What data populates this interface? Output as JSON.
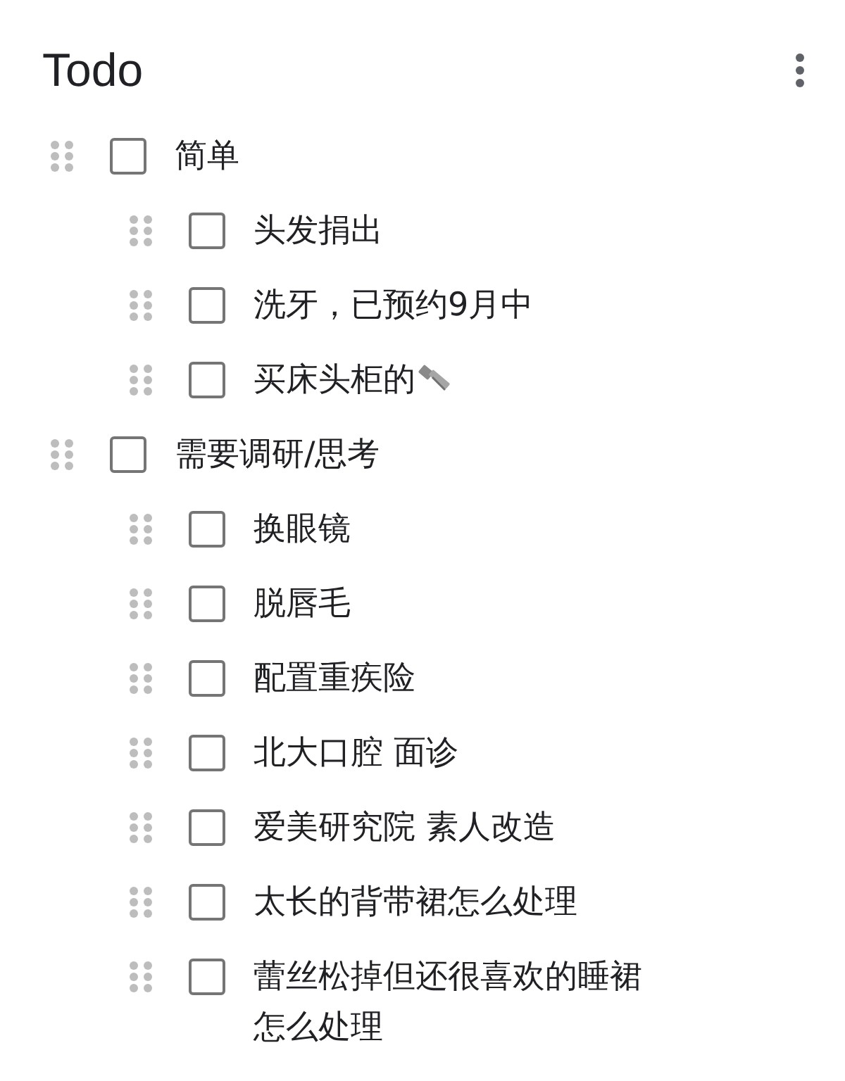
{
  "header": {
    "title": "Todo"
  },
  "items": [
    {
      "text": "简单",
      "checked": false,
      "children": [
        {
          "text": "头发捐出",
          "checked": false
        },
        {
          "text": "洗牙，已预约9月中",
          "checked": false
        },
        {
          "text": "买床头柜的",
          "checked": false,
          "bolt_icon": true
        }
      ]
    },
    {
      "text": "需要调研/思考",
      "checked": false,
      "children": [
        {
          "text": "换眼镜",
          "checked": false
        },
        {
          "text": "脱唇毛",
          "checked": false
        },
        {
          "text": "配置重疾险",
          "checked": false
        },
        {
          "text": "北大口腔 面诊",
          "checked": false
        },
        {
          "text": "爱美研究院 素人改造",
          "checked": false
        },
        {
          "text": "太长的背带裙怎么处理",
          "checked": false
        },
        {
          "text": "蕾丝松掉但还很喜欢的睡裙怎么处理",
          "checked": false
        }
      ]
    }
  ]
}
